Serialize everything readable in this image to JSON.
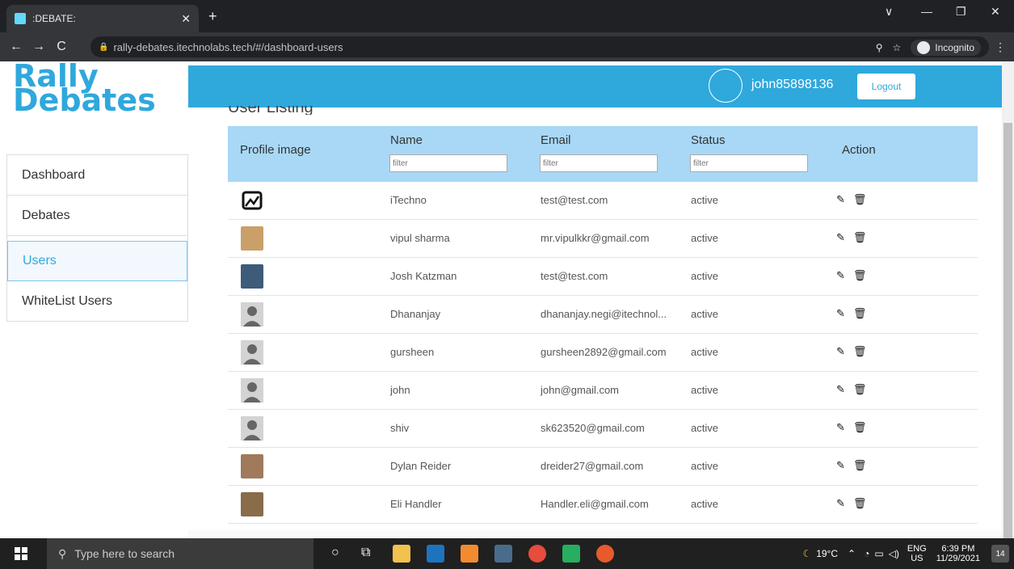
{
  "browser": {
    "tab_title": ":DEBATE:",
    "tab_close": "✕",
    "new_tab": "+",
    "url": "rally-debates.itechnolabs.tech/#/dashboard-users",
    "incognito_label": "Incognito",
    "back": "←",
    "forward": "→",
    "reload": "C",
    "minimize": "—",
    "restore": "❐",
    "close": "✕",
    "chevron": "∨"
  },
  "app": {
    "logo_line1": "Rally",
    "logo_line2": "Debates",
    "brand_color": "#2fa8dc",
    "username": "john85898136",
    "logout_label": "Logout",
    "section_title": "User Listing"
  },
  "sidebar": {
    "items": [
      {
        "label": "Dashboard"
      },
      {
        "label": "Debates"
      },
      {
        "label": "Users"
      },
      {
        "label": "WhiteList Users"
      }
    ]
  },
  "table": {
    "headers": {
      "profile": "Profile image",
      "name": "Name",
      "email": "Email",
      "status": "Status",
      "action": "Action"
    },
    "filter_placeholder": "filter",
    "rows": [
      {
        "name": "iTechno",
        "email": "test@test.com",
        "status": "active",
        "avatar": "broken-image-icon"
      },
      {
        "name": "vipul sharma",
        "email": "mr.vipulkkr@gmail.com",
        "status": "active",
        "avatar": "photo"
      },
      {
        "name": "Josh Katzman",
        "email": "test@test.com",
        "status": "active",
        "avatar": "photo"
      },
      {
        "name": "Dhananjay",
        "email": "dhananjay.negi@itechnol...",
        "status": "active",
        "avatar": "default-user-icon"
      },
      {
        "name": "gursheen",
        "email": "gursheen2892@gmail.com",
        "status": "active",
        "avatar": "default-user-icon"
      },
      {
        "name": "john",
        "email": "john@gmail.com",
        "status": "active",
        "avatar": "default-user-icon"
      },
      {
        "name": "shiv",
        "email": "sk623520@gmail.com",
        "status": "active",
        "avatar": "default-user-icon"
      },
      {
        "name": "Dylan Reider",
        "email": "dreider27@gmail.com",
        "status": "active",
        "avatar": "photo"
      },
      {
        "name": "Eli Handler",
        "email": "Handler.eli@gmail.com",
        "status": "active",
        "avatar": "photo"
      }
    ],
    "edit_icon": "✎",
    "delete_icon": "🗑"
  },
  "taskbar": {
    "search_placeholder": "Type here to search",
    "weather": "19°C",
    "lang_line1": "ENG",
    "lang_line2": "US",
    "time": "6:39 PM",
    "date": "11/29/2021",
    "notifications": "14"
  }
}
